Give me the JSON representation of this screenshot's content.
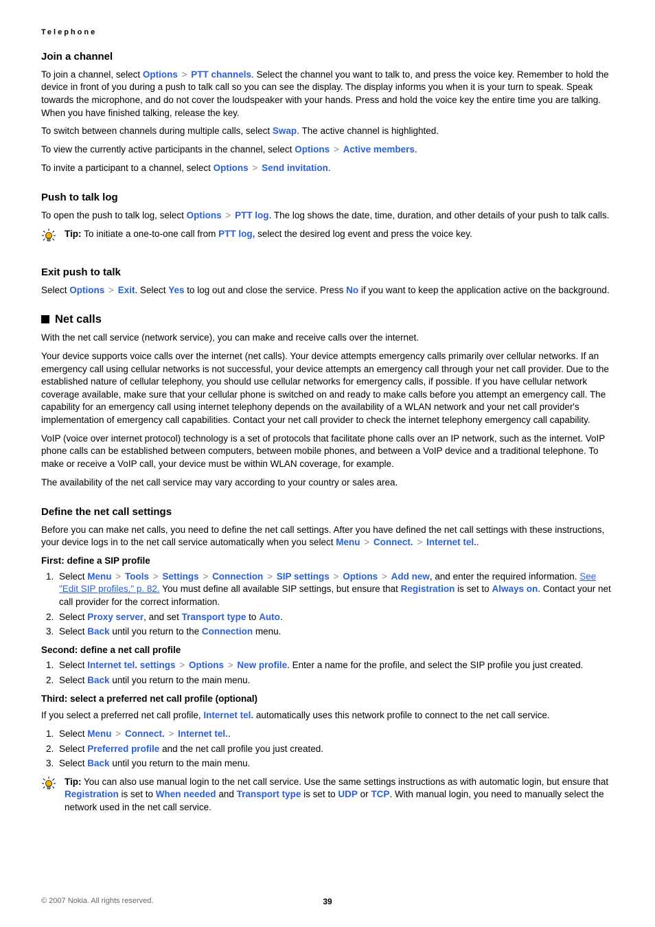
{
  "section_tag": "Telephone",
  "join": {
    "heading": "Join a channel",
    "p1_a": "To join a channel, select ",
    "opt": "Options",
    "gt": ">",
    "ptt_ch": "PTT channels",
    "p1_b": ". Select the channel you want to talk to, and press the voice key. Remember to hold the device in front of you during a push to talk call so you can see the display. The display informs you when it is your turn to speak. Speak towards the microphone, and do not cover the loudspeaker with your hands. Press and hold the voice key the entire time you are talking. When you have finished talking, release the key.",
    "p2_a": "To switch between channels during multiple calls, select ",
    "swap": "Swap",
    "p2_b": ". The active channel is highlighted.",
    "p3_a": "To view the currently active participants in the channel, select ",
    "active_members": "Active members",
    "p4_a": "To invite a participant to a channel, select ",
    "send_inv": "Send invitation"
  },
  "pttlog": {
    "heading": "Push to talk log",
    "p1_a": "To open the push to talk log, select ",
    "opt": "Options",
    "ptt_log": "PTT log",
    "p1_b": ". The log shows the date, time, duration, and other details of your push to talk calls.",
    "tip_label": "Tip: ",
    "tip_a": " To initiate a one-to-one call from ",
    "tip_b": " select the desired log event and press the voice key.",
    "ptt_log_comma": "PTT log,"
  },
  "exit": {
    "heading": "Exit push to talk",
    "p1_a": "Select ",
    "opt": "Options",
    "exit": "Exit",
    "p1_b": ". Select ",
    "yes": "Yes",
    "p1_c": " to log out and close the service. Press ",
    "no": "No",
    "p1_d": " if you want to keep the application active on the background."
  },
  "netcalls": {
    "heading": "Net calls",
    "p1": "With the net call service (network service), you can make and receive calls over the internet.",
    "p2": "Your device supports voice calls over the internet (net calls). Your device attempts emergency calls primarily over cellular networks. If an emergency call using cellular networks is not successful, your device attempts an emergency call through your net call provider. Due to the established nature of cellular telephony, you should use cellular networks for emergency calls, if possible. If you have cellular network coverage available, make sure that your cellular phone is switched on and ready to make calls before you attempt an emergency call. The capability for an emergency call using internet telephony depends on the availability of a WLAN network and your net call provider's implementation of emergency call capabilities. Contact your net call provider to check the internet telephony emergency call capability.",
    "p3": "VoIP (voice over internet protocol) technology is a set of protocols that facilitate phone calls over an IP network, such as the internet. VoIP phone calls can be established between computers, between mobile phones, and between a VoIP device and a traditional telephone. To make or receive a VoIP call, your device must be within WLAN coverage, for example.",
    "p4": "The availability of the net call service may vary according to your country or sales area."
  },
  "define": {
    "heading": "Define the net call settings",
    "p1_a": "Before you can make net calls, you need to define the net call settings. After you have defined the net call settings with these instructions, your device logs in to the net call service automatically when you select ",
    "menu": "Menu",
    "connect": "Connect.",
    "internet_tel": "Internet tel.",
    "first_h": "First: define a SIP profile",
    "first_1a": "Select ",
    "tools": "Tools",
    "settings": "Settings",
    "connection": "Connection",
    "sip_settings": "SIP settings",
    "options": "Options",
    "add_new": "Add new",
    "first_1b": ", and enter the required information. ",
    "see_link": "See \"Edit SIP profiles,\" p. 82.",
    "first_1c": " You must define all available SIP settings, but ensure that ",
    "registration": "Registration",
    "first_1d": " is set to ",
    "always_on": "Always on",
    "first_1e": ". Contact your net call provider for the correct information.",
    "first_2a": "Select ",
    "proxy_server": "Proxy server",
    "first_2b": ", and set ",
    "transport_type": "Transport type",
    "first_2c": " to ",
    "auto": "Auto",
    "first_3a": "Select ",
    "back": "Back",
    "first_3b": " until you return to the ",
    "first_3c": " menu.",
    "second_h": "Second: define a net call profile",
    "second_1a": "Select ",
    "internet_tel_settings": "Internet tel. settings",
    "new_profile": "New profile",
    "second_1b": ". Enter a name for the profile, and select the SIP profile you just created.",
    "second_2a": "Select ",
    "second_2b": " until you return to the main menu.",
    "third_h": "Third: select a preferred net call profile (optional)",
    "third_p_a": "If you select a preferred net call profile, ",
    "internet_tel_plain": "Internet tel.",
    "third_p_b": " automatically uses this network profile to connect to the net call service.",
    "third_1a": "Select ",
    "third_2a": "Select ",
    "preferred_profile": "Preferred profile",
    "third_2b": " and the net call profile you just created.",
    "third_3a": "Select ",
    "third_3b": " until you return to the main menu.",
    "tip_label": "Tip:",
    "tip_a": " You can also use manual login to the net call service. Use the same settings instructions as with automatic login, but ensure that ",
    "tip_b": " is set to ",
    "when_needed": "When needed",
    "tip_c": " and ",
    "tip_d": " is set to ",
    "udp": "UDP",
    "tip_e": " or ",
    "tcp": "TCP",
    "tip_f": ". With manual login, you need to manually select the network used in the net call service."
  },
  "footer": {
    "copyright": "© 2007 Nokia. All rights reserved.",
    "page": "39"
  }
}
